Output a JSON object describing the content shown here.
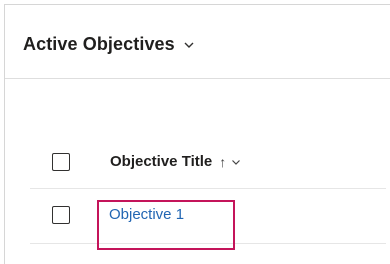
{
  "view": {
    "title": "Active Objectives",
    "dropdown_icon": "chevron-down-icon"
  },
  "grid": {
    "columns": [
      {
        "label": "Objective Title",
        "sort_icon": "arrow-up-icon",
        "sort_glyph": "↑",
        "menu_icon": "chevron-down-icon"
      }
    ],
    "rows": [
      {
        "title": "Objective 1"
      }
    ]
  },
  "colors": {
    "link": "#2266b3",
    "highlight": "#c4145a"
  }
}
